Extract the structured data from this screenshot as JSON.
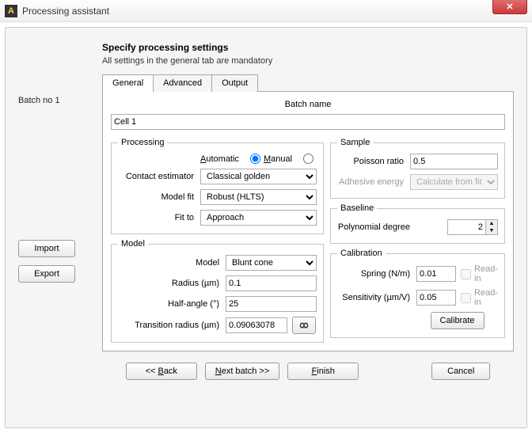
{
  "window": {
    "title": "Processing assistant",
    "app_icon_glyph": "A"
  },
  "heading": "Specify processing settings",
  "subheading": "All settings in the general tab are mandatory",
  "batch_label": "Batch no 1",
  "buttons": {
    "import": "Import",
    "export": "Export",
    "calibrate": "Calibrate",
    "back_prefix": "<<  ",
    "back_key": "B",
    "back_rest": "ack",
    "next_key": "N",
    "next_rest": "ext batch  >>",
    "finish_key": "F",
    "finish_rest": "inish",
    "cancel": "Cancel"
  },
  "tabs": {
    "general": "General",
    "advanced": "Advanced",
    "output": "Output"
  },
  "batch_name": {
    "label": "Batch name",
    "value": "Cell 1"
  },
  "processing": {
    "legend": "Processing",
    "auto_key": "A",
    "auto_rest": "utomatic",
    "manual_key": "M",
    "manual_rest": "anual",
    "contact_estimator": {
      "label": "Contact estimator",
      "value": "Classical golden"
    },
    "model_fit": {
      "label": "Model fit",
      "value": "Robust (HLTS)"
    },
    "fit_to": {
      "label": "Fit to",
      "value": "Approach"
    }
  },
  "model": {
    "legend": "Model",
    "model": {
      "label": "Model",
      "value": "Blunt cone"
    },
    "radius": {
      "label": "Radius (µm)",
      "value": "0.1"
    },
    "half_angle": {
      "label": "Half-angle (°)",
      "value": "25"
    },
    "transition_radius": {
      "label": "Transition radius (µm)",
      "value": "0.09063078"
    }
  },
  "sample": {
    "legend": "Sample",
    "poisson": {
      "label": "Poisson ratio",
      "value": "0.5"
    },
    "adhesive": {
      "label": "Adhesive energy",
      "value": "Calculate from fit"
    }
  },
  "baseline": {
    "legend": "Baseline",
    "polynomial": {
      "label": "Polynomial degree",
      "value": "2"
    }
  },
  "calibration": {
    "legend": "Calibration",
    "spring": {
      "label": "Spring (N/m)",
      "value": "0.01"
    },
    "sensitivity": {
      "label": "Sensitivity (µm/V)",
      "value": "0.05"
    },
    "readin": "Read-in"
  }
}
